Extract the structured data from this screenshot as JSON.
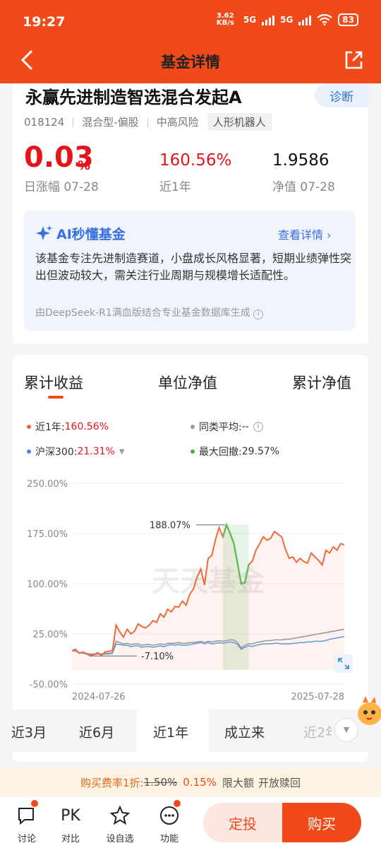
{
  "status": {
    "time": "19:27",
    "speed": "3.62 KB/s",
    "net1": "5G",
    "net2": "5G",
    "battery": "83"
  },
  "nav": {
    "title": "基金详情"
  },
  "fund": {
    "name": "永赢先进制造智选混合发起A",
    "diagnose": "诊断",
    "code": "018124",
    "type": "混合型-偏股",
    "risk": "中高风险",
    "tag": "人形机器人",
    "daily_change_value": "0.03",
    "daily_change_unit": "%",
    "daily_change_label": "日涨幅 07-28",
    "year_return": "160.56%",
    "year_return_label": "近1年",
    "nav_value": "1.9586",
    "nav_label": "净值 07-28"
  },
  "ai": {
    "title": "AI秒懂基金",
    "more": "查看详情",
    "text": "该基金专注先进制造赛道，小盘成长风格显著，短期业绩弹性突出但波动较大，需关注行业周期与规模增长适配性。",
    "source": "由DeepSeek-R1满血版结合专业基金数据库生成"
  },
  "tabs": [
    "累计收益",
    "单位净值",
    "累计净值"
  ],
  "legend": {
    "fund_label": "近1年:",
    "fund_value": "160.56%",
    "peer_label": "同类平均:",
    "peer_value": "--",
    "index_label": "沪深300:",
    "index_value": "21.31%",
    "drawdown_label": "最大回撤:",
    "drawdown_value": "29.57%"
  },
  "chart_data": {
    "type": "line",
    "y_ticks": [
      "250.00%",
      "175.00%",
      "100.00%",
      "25.00%",
      "-50.00%"
    ],
    "ylim": [
      -50,
      250
    ],
    "x_start": "2024-07-26",
    "x_end": "2025-07-28",
    "watermark": "天天基金",
    "annotations": {
      "max": "188.07%",
      "min": "-7.10%"
    },
    "colors": {
      "fund": "#ee6a3a",
      "index": "#6b9bd8",
      "peer": "#999999",
      "drawdown": "#5dbb57"
    },
    "series": [
      {
        "name": "近1年",
        "values": [
          0,
          2,
          -4,
          -2,
          -5,
          -8,
          -6,
          -3,
          -7,
          -2,
          -1,
          0,
          38,
          28,
          20,
          32,
          25,
          29,
          40,
          36,
          34,
          38,
          45,
          42,
          55,
          50,
          62,
          58,
          66,
          65,
          74,
          68,
          84,
          92,
          110,
          122,
          98,
          138,
          142,
          166,
          184,
          170,
          188,
          175,
          160,
          130,
          100,
          102,
          128,
          134,
          150,
          160,
          170,
          165,
          168,
          178,
          174,
          170,
          152,
          138,
          140,
          132,
          138,
          133,
          131,
          146,
          140,
          135,
          128,
          150,
          146,
          155,
          150,
          160,
          158
        ]
      },
      {
        "name": "沪深300",
        "values": [
          0,
          -1,
          -3,
          -4,
          -5,
          -6,
          -6,
          -5,
          -6,
          -5,
          -5,
          -4,
          10,
          9,
          8,
          8,
          6,
          7,
          7,
          5,
          6,
          6,
          5,
          6,
          7,
          6,
          8,
          9,
          8,
          9,
          8,
          8,
          9,
          10,
          11,
          12,
          10,
          12,
          10,
          11,
          12,
          11,
          12,
          13,
          12,
          9,
          2,
          5,
          7,
          6,
          8,
          9,
          10,
          10,
          10,
          11,
          11,
          10,
          10,
          10,
          11,
          11,
          12,
          12,
          13,
          13,
          14,
          14,
          14,
          15,
          17,
          18,
          19,
          20,
          21
        ]
      },
      {
        "name": "同类平均",
        "values": [
          0,
          -1,
          -3,
          -3,
          -4,
          -5,
          -5,
          -4,
          -5,
          -4,
          -4,
          -3,
          14,
          12,
          10,
          11,
          9,
          10,
          10,
          8,
          9,
          9,
          8,
          9,
          10,
          9,
          11,
          11,
          11,
          12,
          11,
          11,
          12,
          12,
          13,
          14,
          12,
          14,
          13,
          14,
          15,
          14,
          15,
          16,
          16,
          12,
          4,
          8,
          10,
          10,
          12,
          13,
          14,
          15,
          15,
          16,
          16,
          16,
          17,
          17,
          18,
          19,
          20,
          21,
          22,
          23,
          24,
          25,
          26,
          27,
          28,
          29,
          30,
          31,
          32
        ]
      }
    ],
    "drawdown_range": [
      41,
      48
    ]
  },
  "ranges": [
    "近3月",
    "近6月",
    "近1年",
    "成立来",
    "近2年"
  ],
  "promo": {
    "prefix": "购买费率1折:",
    "old": "1.50%",
    "new": "0.15%",
    "limit": "限大额",
    "redeem": "开放赎回"
  },
  "bottom": {
    "discuss": "讨论",
    "pk": "PK",
    "compare": "对比",
    "watch": "设自选",
    "functions": "功能",
    "dingtou": "定投",
    "buy": "购买"
  }
}
